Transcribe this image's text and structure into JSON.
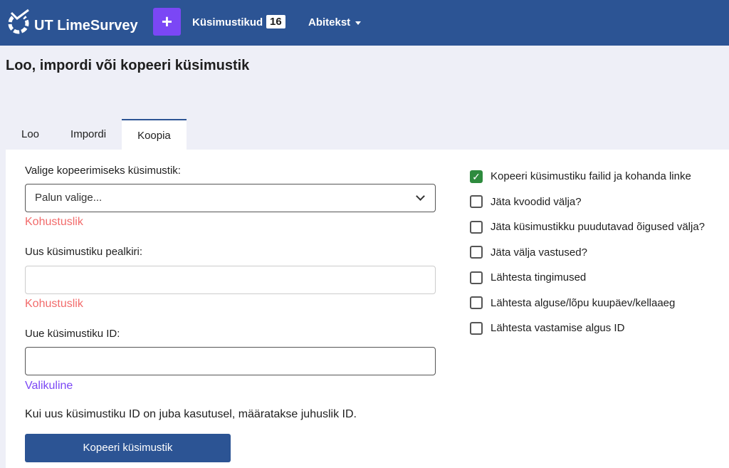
{
  "header": {
    "brand": "UT LimeSurvey",
    "add_label": "+",
    "surveys_label": "Küsimustikud",
    "surveys_count": "16",
    "help_label": "Abitekst"
  },
  "page_title": "Loo, impordi või kopeeri küsimustik",
  "tabs": [
    {
      "label": "Loo"
    },
    {
      "label": "Impordi"
    },
    {
      "label": "Koopia"
    }
  ],
  "form": {
    "select_label": "Valige kopeerimiseks küsimustik:",
    "select_value": "Palun valige...",
    "required1": "Kohustuslik",
    "title_label": "Uus küsimustiku pealkiri:",
    "title_value": "",
    "required2": "Kohustuslik",
    "id_label": "Uue küsimustiku ID:",
    "id_value": "",
    "optional": "Valikuline",
    "note": "Kui uus küsimustiku ID on juba kasutusel, määratakse juhuslik ID.",
    "submit": "Kopeeri küsimustik"
  },
  "options": [
    {
      "label": "Kopeeri küsimustiku failid ja kohanda linke",
      "checked": true
    },
    {
      "label": "Jäta kvoodid välja?",
      "checked": false
    },
    {
      "label": "Jäta küsimustikku puudutavad õigused välja?",
      "checked": false
    },
    {
      "label": "Jäta välja vastused?",
      "checked": false
    },
    {
      "label": "Lähtesta tingimused",
      "checked": false
    },
    {
      "label": "Lähtesta alguse/lõpu kuupäev/kellaaeg",
      "checked": false
    },
    {
      "label": "Lähtesta vastamise algus ID",
      "checked": false
    }
  ]
}
